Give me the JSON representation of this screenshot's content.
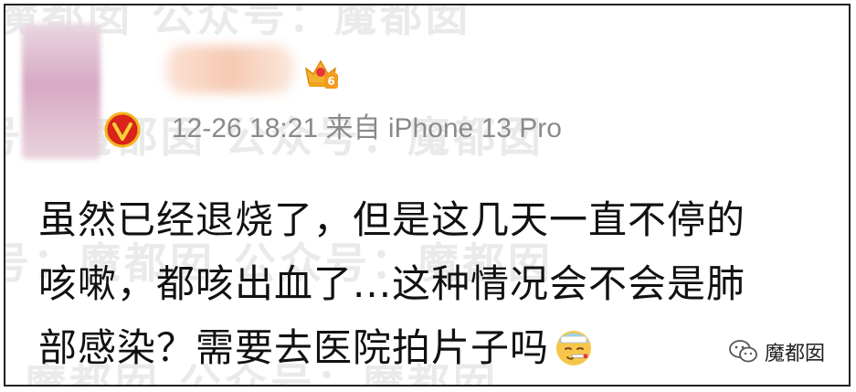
{
  "watermark": {
    "text_row1": "魔都囡  公众号：魔都囡",
    "text_row2": "公众号：魔都囡  公众号：魔都囡",
    "text_row3": "公众号：魔都囡  公众号：魔都囡",
    "text_row4": "魔都囡  公众号：魔都囡"
  },
  "post": {
    "timestamp": "12-26 18:21",
    "source_prefix": "来自",
    "device": "iPhone 13 Pro",
    "level_badge": "6",
    "comment_lines": [
      "虽然已经退烧了，但是这几天一直不停的",
      "咳嗽，都咳出血了...这种情况会不会是肺",
      "部感染？需要去医院拍片子吗"
    ],
    "emoji_icon": "sick-thermometer-emoji"
  },
  "footer": {
    "account_icon": "wechat-icon",
    "account_name": "魔都囡"
  },
  "colors": {
    "meta_text": "#8a8a8a",
    "comment_text": "#111111",
    "badge_red": "#d9231b",
    "crown_gold": "#f3b12c"
  }
}
